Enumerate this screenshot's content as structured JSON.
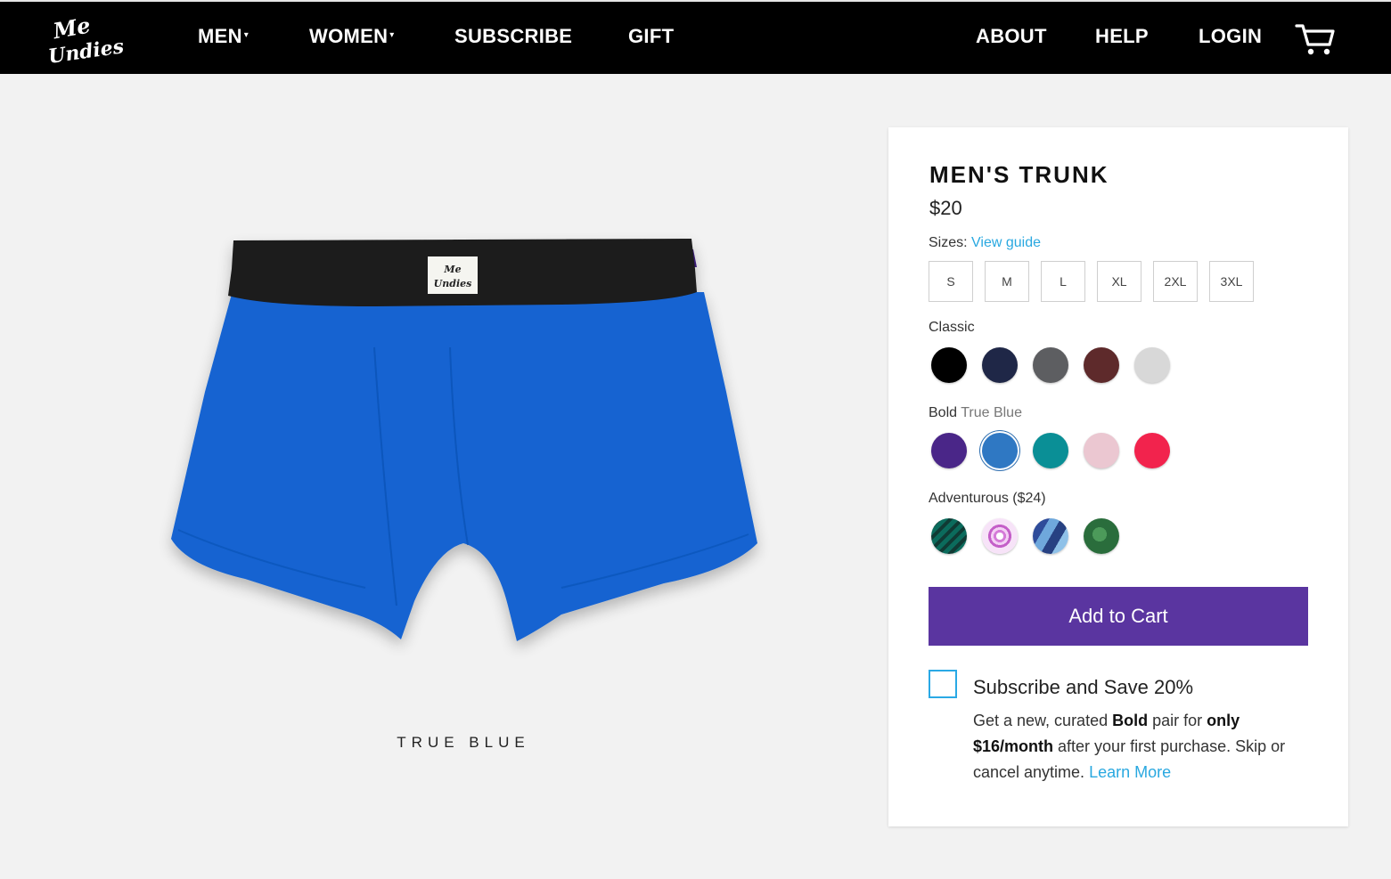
{
  "nav": {
    "logo_text": "Me Undies",
    "items": [
      {
        "label": "MEN",
        "has_dropdown": true
      },
      {
        "label": "WOMEN",
        "has_dropdown": true
      },
      {
        "label": "SUBSCRIBE"
      },
      {
        "label": "GIFT"
      }
    ],
    "right_items": [
      {
        "label": "ABOUT"
      },
      {
        "label": "HELP"
      },
      {
        "label": "LOGIN"
      }
    ],
    "caret": "▾",
    "cart_icon": "cart-icon"
  },
  "product": {
    "color_caption": "TRUE BLUE",
    "image_label": "Me Undies",
    "colors": {
      "body": "#1363d1",
      "waistband": "#1a1a1a",
      "inner": "#3b1f78"
    }
  },
  "panel": {
    "title": "MEN'S TRUNK",
    "price": "$20",
    "sizes_label": "Sizes:",
    "size_guide_link": "View guide",
    "sizes": [
      "S",
      "M",
      "L",
      "XL",
      "2XL",
      "3XL"
    ],
    "classic": {
      "label": "Classic",
      "swatches": [
        "#000000",
        "#1f2747",
        "#5d5e61",
        "#5e2a2b",
        "#d8d8d8"
      ]
    },
    "bold": {
      "label": "Bold",
      "selected_name": "True Blue",
      "swatches": [
        "#4a2688",
        "#2f78c3",
        "#0a8f96",
        "#ebc7d1",
        "#f2234d"
      ],
      "selected_index": 1
    },
    "adventurous": {
      "label": "Adventurous ($24)",
      "swatches": [
        "teal-zigzag-pattern",
        "pink-floral-pattern",
        "blue-camo-pattern",
        "green-bird-pattern"
      ]
    },
    "add_to_cart": "Add to Cart",
    "subscribe": {
      "title": "Subscribe and Save 20%",
      "desc_1": "Get a new, curated ",
      "desc_bold_1": "Bold",
      "desc_2": " pair for ",
      "desc_bold_2": "only",
      "desc_bold_3": "$16/month",
      "desc_3": " after your first purchase. Skip or cancel anytime. ",
      "learn_more": "Learn More"
    }
  },
  "colors": {
    "nav_bg": "#000000",
    "accent_purple": "#5a35a0",
    "link_blue": "#29a8e0",
    "page_bg": "#f2f2f2"
  }
}
